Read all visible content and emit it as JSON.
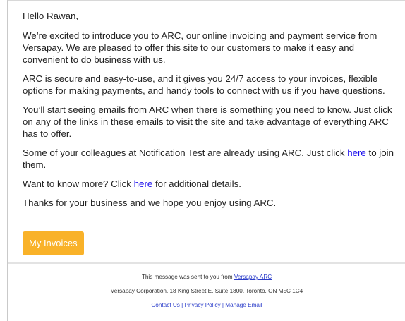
{
  "email": {
    "greeting": "Hello Rawan,",
    "paragraphs": {
      "intro": "We’re excited to introduce you to ARC, our online invoicing and payment service from Versapay. We are pleased to offer this site to our customers to make it easy and convenient to do business with us.",
      "secure": "ARC is secure and easy-to-use, and it gives you 24/7 access to your invoices, flexible options for making payments, and handy tools to connect with us if you have questions.",
      "emails": "You’ll start seeing emails from ARC when there is something you need to know. Just click on any of the links in these emails to visit the site and take advantage of everything ARC has to offer.",
      "colleagues_before": "Some of your colleagues at Notification Test are already using ARC. Just click ",
      "colleagues_link": "here",
      "colleagues_after": " to join them.",
      "more_before": "Want to know more? Click ",
      "more_link": "here",
      "more_after": " for additional details.",
      "thanks": "Thanks for your business and we hope you enjoy using ARC."
    },
    "cta_label": "My Invoices"
  },
  "footer": {
    "sent_prefix": "This message was sent to you from ",
    "sender_link": "Versapay ARC",
    "address": "Versapay Corporation, 18 King Street E, Suite 1800, Toronto, ON M5C 1C4",
    "links": {
      "contact": "Contact Us",
      "privacy": "Privacy Policy",
      "manage": "Manage Email",
      "separator": "|"
    }
  },
  "colors": {
    "cta_background": "#f9b229",
    "link": "#1a0dee",
    "text": "#222222"
  }
}
